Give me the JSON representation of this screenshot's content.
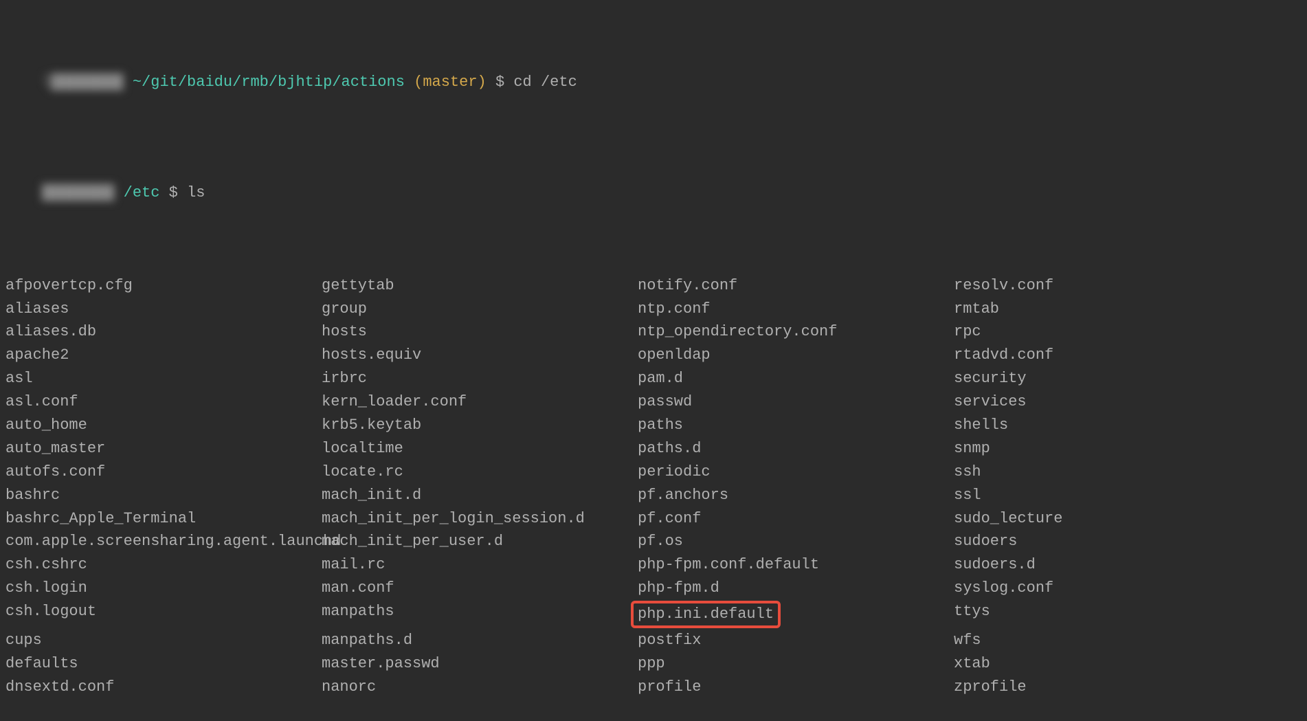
{
  "prompt1": {
    "userHost": "l████████",
    "path": "~/git/baidu/rmb/bjhtip/actions",
    "branch": "(master)",
    "symbol": "$",
    "command": "cd /etc"
  },
  "prompt2": {
    "userHost": "████████",
    "path": "/etc",
    "symbol": "$",
    "command": "ls"
  },
  "highlightedFile": "php.ini.default",
  "columns": [
    [
      "afpovertcp.cfg",
      "aliases",
      "aliases.db",
      "apache2",
      "asl",
      "asl.conf",
      "auto_home",
      "auto_master",
      "autofs.conf",
      "bashrc",
      "bashrc_Apple_Terminal",
      "com.apple.screensharing.agent.launchd",
      "csh.cshrc",
      "csh.login",
      "csh.logout",
      "cups",
      "defaults",
      "dnsextd.conf"
    ],
    [
      "gettytab",
      "group",
      "hosts",
      "hosts.equiv",
      "irbrc",
      "kern_loader.conf",
      "krb5.keytab",
      "localtime",
      "locate.rc",
      "mach_init.d",
      "mach_init_per_login_session.d",
      "mach_init_per_user.d",
      "mail.rc",
      "man.conf",
      "manpaths",
      "manpaths.d",
      "master.passwd",
      "nanorc"
    ],
    [
      "notify.conf",
      "ntp.conf",
      "ntp_opendirectory.conf",
      "openldap",
      "pam.d",
      "passwd",
      "paths",
      "paths.d",
      "periodic",
      "pf.anchors",
      "pf.conf",
      "pf.os",
      "php-fpm.conf.default",
      "php-fpm.d",
      "php.ini.default",
      "postfix",
      "ppp",
      "profile"
    ],
    [
      "resolv.conf",
      "rmtab",
      "rpc",
      "rtadvd.conf",
      "security",
      "services",
      "shells",
      "snmp",
      "ssh",
      "ssl",
      "sudo_lecture",
      "sudoers",
      "sudoers.d",
      "syslog.conf",
      "ttys",
      "wfs",
      "xtab",
      "zprofile"
    ]
  ]
}
